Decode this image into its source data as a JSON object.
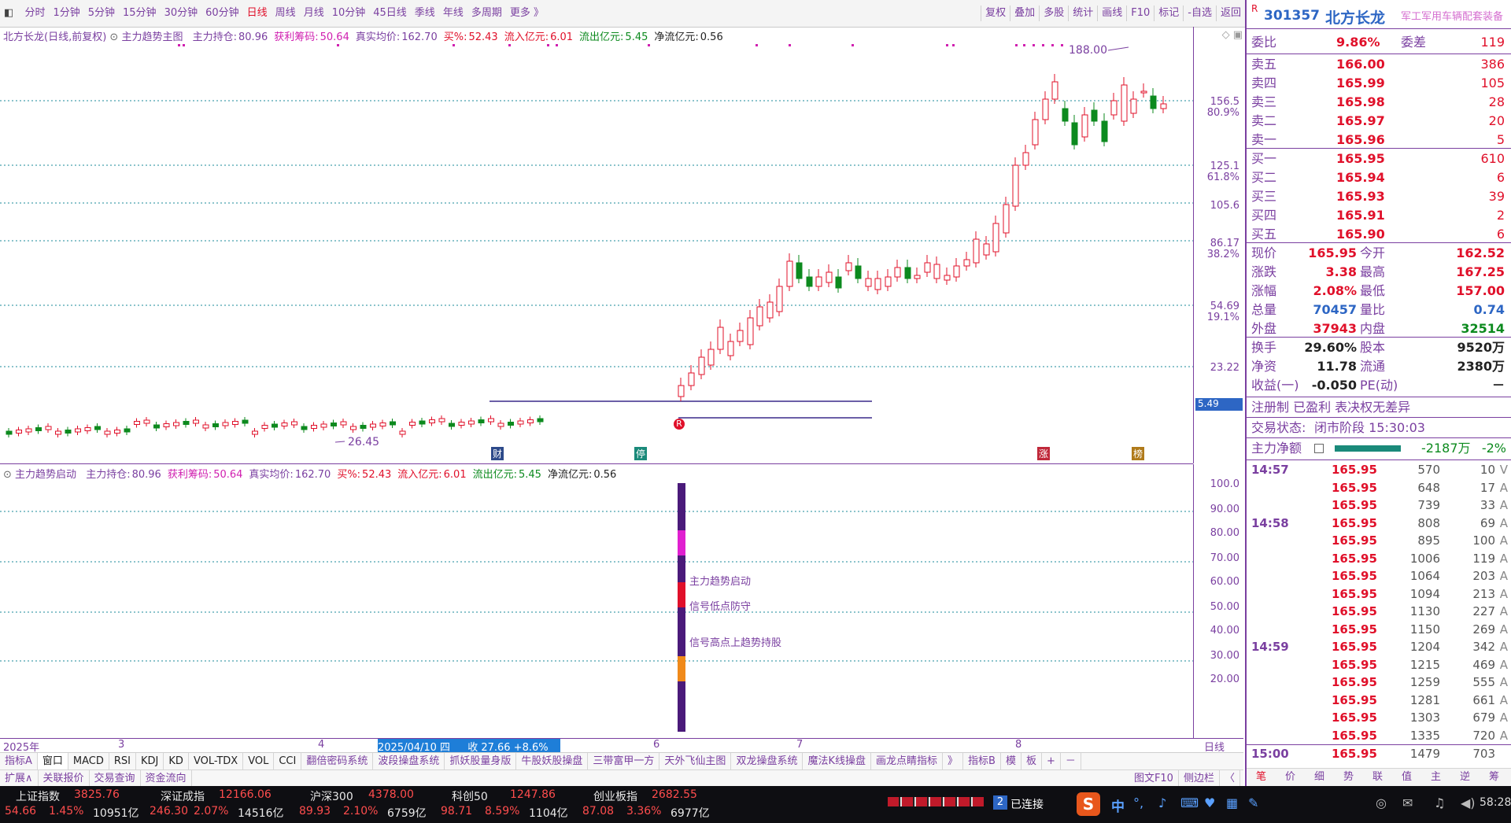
{
  "toolbar": {
    "left_items": [
      "分时",
      "1分钟",
      "5分钟",
      "15分钟",
      "30分钟",
      "60分钟",
      "日线",
      "周线",
      "月线",
      "10分钟",
      "45日线",
      "季线",
      "年线",
      "多周期",
      "更多 》"
    ],
    "right_items": [
      "复权",
      "叠加",
      "多股",
      "统计",
      "画线",
      "F10",
      "标记",
      "-自选",
      "返回"
    ]
  },
  "main_chart": {
    "title": "北方长龙(日线,前复权)",
    "indicator_name": "主力趋势主图",
    "stats": [
      {
        "label": "主力持仓:",
        "value": "80.96",
        "color": "#7a3fa0"
      },
      {
        "label": "获利筹码:",
        "value": "50.64",
        "color": "#d020b0"
      },
      {
        "label": "真实均价:",
        "value": "162.70",
        "color": "#7a3fa0"
      },
      {
        "label": "买%:",
        "value": "52.43",
        "color": "#e0102a"
      },
      {
        "label": "流入亿元:",
        "value": "6.01",
        "color": "#e0102a"
      },
      {
        "label": "流出亿元:",
        "value": "5.45",
        "color": "#0c8a1e"
      },
      {
        "label": "净流亿元:",
        "value": "0.56",
        "color": "#222"
      }
    ],
    "high_label": "188.00",
    "low_label": "26.45",
    "marker_R": "R",
    "marker_cai": "财",
    "marker_ting": "停",
    "marker_zhang": "涨",
    "marker_bang": "榜",
    "yaxis": [
      {
        "price": "156.5",
        "pct": "80.9%"
      },
      {
        "price": "125.1",
        "pct": "61.8%"
      },
      {
        "price": "105.6",
        "pct": ""
      },
      {
        "price": "86.17",
        "pct": "38.2%"
      },
      {
        "price": "54.69",
        "pct": "19.1%"
      },
      {
        "price": "23.22",
        "pct": ""
      }
    ],
    "side_badge": "5.49"
  },
  "lower_chart": {
    "indicator_name": "主力趋势启动",
    "stats": [
      {
        "label": "主力持仓:",
        "value": "80.96",
        "color": "#7a3fa0"
      },
      {
        "label": "获利筹码:",
        "value": "50.64",
        "color": "#d020b0"
      },
      {
        "label": "真实均价:",
        "value": "162.70",
        "color": "#7a3fa0"
      },
      {
        "label": "买%:",
        "value": "52.43",
        "color": "#e0102a"
      },
      {
        "label": "流入亿元:",
        "value": "6.01",
        "color": "#e0102a"
      },
      {
        "label": "流出亿元:",
        "value": "5.45",
        "color": "#0c8a1e"
      },
      {
        "label": "净流亿元:",
        "value": "0.56",
        "color": "#222"
      }
    ],
    "legend": [
      "主力趋势启动",
      "信号低点防守",
      "信号高点上趋势持股"
    ],
    "yaxis": [
      "100.0",
      "90.00",
      "80.00",
      "70.00",
      "60.00",
      "50.00",
      "40.00",
      "30.00",
      "20.00"
    ]
  },
  "date_axis": {
    "labels": [
      "2025年",
      "3",
      "4",
      "6",
      "7",
      "8"
    ],
    "selected": "2025/04/10 四",
    "selected_value": "收 27.66 +8.6%",
    "right_label": "日线"
  },
  "indicator_tabs": [
    "指标A",
    "窗口",
    "MACD",
    "RSI",
    "KDJ",
    "KD",
    "VOL-TDX",
    "VOL",
    "CCI",
    "翻倍密码系统",
    "波段操盘系统",
    "抓妖股量身版",
    "牛股妖股操盘",
    "三带富甲一方",
    "天外飞仙主图",
    "双龙操盘系统",
    "魔法K线操盘",
    "画龙点睛指标",
    "》",
    "指标B",
    "模",
    "板",
    "+",
    "－"
  ],
  "ext_tabs": [
    "扩展∧",
    "关联报价",
    "交易查询",
    "资金流向"
  ],
  "ext_right": [
    "图文F10",
    "侧边栏",
    "〈"
  ],
  "quote": {
    "code": "301357",
    "name": "北方长龙",
    "r_badge": "R",
    "concept": "军工军用车辆配套装备",
    "weibi_label": "委比",
    "weibi": "9.86%",
    "weicha_label": "委差",
    "weicha": "119",
    "asks": [
      {
        "label": "卖五",
        "price": "166.00",
        "vol": "386"
      },
      {
        "label": "卖四",
        "price": "165.99",
        "vol": "105"
      },
      {
        "label": "卖三",
        "price": "165.98",
        "vol": "28"
      },
      {
        "label": "卖二",
        "price": "165.97",
        "vol": "20"
      },
      {
        "label": "卖一",
        "price": "165.96",
        "vol": "5"
      }
    ],
    "bids": [
      {
        "label": "买一",
        "price": "165.95",
        "vol": "610"
      },
      {
        "label": "买二",
        "price": "165.94",
        "vol": "6"
      },
      {
        "label": "买三",
        "price": "165.93",
        "vol": "39"
      },
      {
        "label": "买四",
        "price": "165.91",
        "vol": "2"
      },
      {
        "label": "买五",
        "price": "165.90",
        "vol": "6"
      }
    ],
    "fields": [
      {
        "l1": "现价",
        "v1": "165.95",
        "l2": "今开",
        "v2": "162.52"
      },
      {
        "l1": "涨跌",
        "v1": "3.38",
        "l2": "最高",
        "v2": "167.25"
      },
      {
        "l1": "涨幅",
        "v1": "2.08%",
        "l2": "最低",
        "v2": "157.00"
      },
      {
        "l1": "总量",
        "v1": "70457",
        "l2": "量比",
        "v2": "0.74"
      },
      {
        "l1": "外盘",
        "v1": "37943",
        "l2": "内盘",
        "v2": "32514"
      }
    ],
    "fields2": [
      {
        "l1": "换手",
        "v1": "29.60%",
        "l2": "股本",
        "v2": "9520万"
      },
      {
        "l1": "净资",
        "v1": "11.78",
        "l2": "流通",
        "v2": "2380万"
      },
      {
        "l1": "收益(一)",
        "v1": "-0.050",
        "l2": "PE(动)",
        "v2": "－"
      }
    ],
    "register_note": "注册制 已盈利 表决权无差异",
    "trade_status_label": "交易状态:",
    "trade_status": "闭市阶段 15:30:03",
    "net_label": "主力净额",
    "net_value": "-2187万",
    "net_pct": "-2%",
    "ticks": [
      {
        "time": "14:57",
        "price": "165.95",
        "vol": "570",
        "num": "10",
        "dir": "V"
      },
      {
        "time": "",
        "price": "165.95",
        "vol": "648",
        "num": "17",
        "dir": "A"
      },
      {
        "time": "",
        "price": "165.95",
        "vol": "739",
        "num": "33",
        "dir": "A"
      },
      {
        "time": "14:58",
        "price": "165.95",
        "vol": "808",
        "num": "69",
        "dir": "A"
      },
      {
        "time": "",
        "price": "165.95",
        "vol": "895",
        "num": "100",
        "dir": "A"
      },
      {
        "time": "",
        "price": "165.95",
        "vol": "1006",
        "num": "119",
        "dir": "A"
      },
      {
        "time": "",
        "price": "165.95",
        "vol": "1064",
        "num": "203",
        "dir": "A"
      },
      {
        "time": "",
        "price": "165.95",
        "vol": "1094",
        "num": "213",
        "dir": "A"
      },
      {
        "time": "",
        "price": "165.95",
        "vol": "1130",
        "num": "227",
        "dir": "A"
      },
      {
        "time": "",
        "price": "165.95",
        "vol": "1150",
        "num": "269",
        "dir": "A"
      },
      {
        "time": "14:59",
        "price": "165.95",
        "vol": "1204",
        "num": "342",
        "dir": "A"
      },
      {
        "time": "",
        "price": "165.95",
        "vol": "1215",
        "num": "469",
        "dir": "A"
      },
      {
        "time": "",
        "price": "165.95",
        "vol": "1259",
        "num": "555",
        "dir": "A"
      },
      {
        "time": "",
        "price": "165.95",
        "vol": "1281",
        "num": "661",
        "dir": "A"
      },
      {
        "time": "",
        "price": "165.95",
        "vol": "1303",
        "num": "679",
        "dir": "A"
      },
      {
        "time": "",
        "price": "165.95",
        "vol": "1335",
        "num": "720",
        "dir": "A"
      },
      {
        "time": "15:00",
        "price": "165.95",
        "vol": "1479",
        "num": "703",
        "dir": ""
      }
    ],
    "bottom_tabs": [
      "笔",
      "价",
      "细",
      "势",
      "联",
      "值",
      "主",
      "逆",
      "筹"
    ]
  },
  "statusbar": {
    "indices": [
      {
        "name": "上证指数",
        "value": "3825.76",
        "chg": "54.66",
        "pct": "1.45%",
        "amt": "10951亿"
      },
      {
        "name": "深证成指",
        "value": "12166.06",
        "chg": "246.30",
        "pct": "2.07%",
        "amt": "14516亿"
      },
      {
        "name": "沪深300",
        "value": "4378.00",
        "chg": "89.93",
        "pct": "2.10%",
        "amt": "6759亿"
      },
      {
        "name": "科创50",
        "value": "1247.86",
        "chg": "98.71",
        "pct": "8.59%",
        "amt": "1104亿"
      },
      {
        "name": "创业板指",
        "value": "2682.55",
        "chg": "87.08",
        "pct": "3.36%",
        "amt": "6977亿"
      }
    ],
    "connection_count": "2",
    "connection_text": "已连接",
    "ime": "中",
    "clock": "58:28"
  }
}
